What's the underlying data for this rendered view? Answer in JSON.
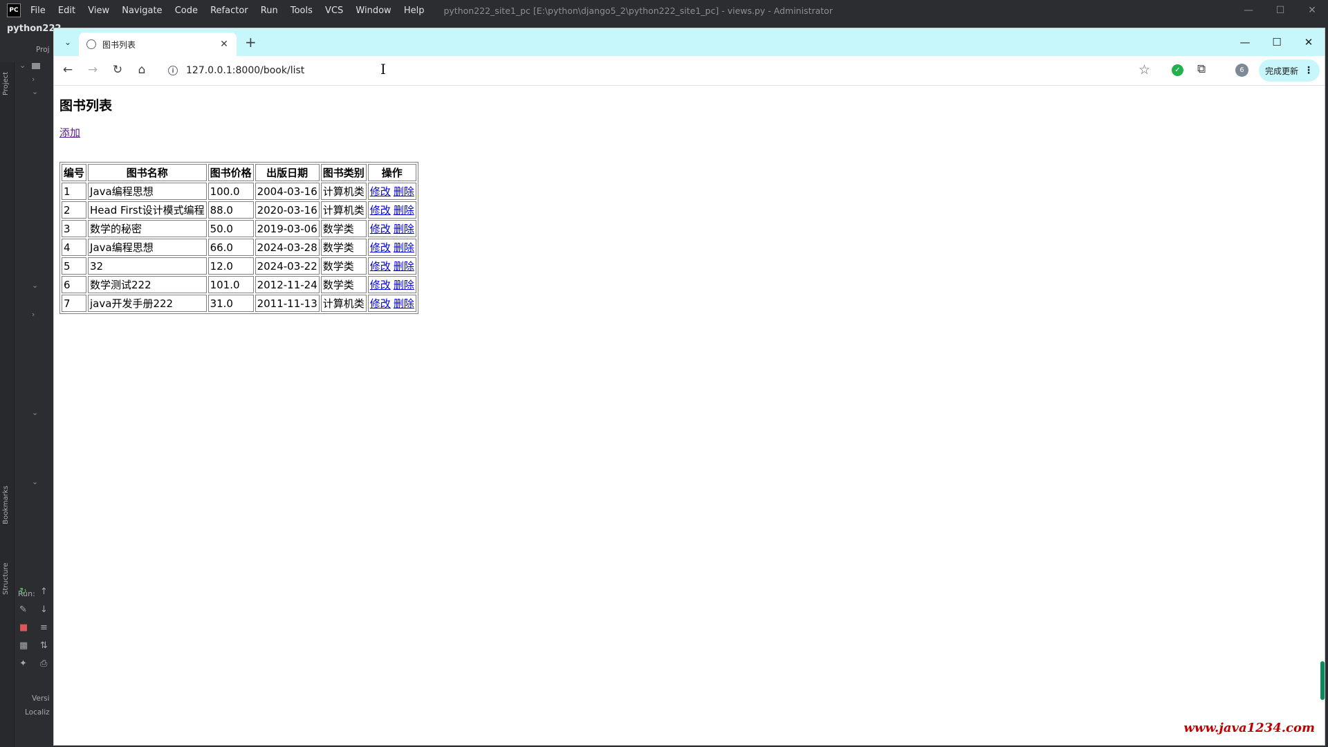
{
  "ide": {
    "logo": "PC",
    "menu": [
      "File",
      "Edit",
      "View",
      "Navigate",
      "Code",
      "Refactor",
      "Run",
      "Tools",
      "VCS",
      "Window",
      "Help"
    ],
    "window_title": "python222_site1_pc [E:\\python\\django5_2\\python222_site1_pc] - views.py - Administrator",
    "project_label": "python222",
    "project_tab": "Proj",
    "side_labels": [
      "Project",
      "Bookmarks",
      "Structure"
    ],
    "run_label": "Run:",
    "bottom_labels": [
      "Versi",
      "Localiz"
    ]
  },
  "browser": {
    "tab_title": "图书列表",
    "url": "127.0.0.1:8000/book/list",
    "update_button": "完成更新",
    "profile_initial": "6"
  },
  "page": {
    "title": "图书列表",
    "add_link": "添加",
    "table": {
      "headers": [
        "编号",
        "图书名称",
        "图书价格",
        "出版日期",
        "图书类别",
        "操作"
      ],
      "edit_label": "修改",
      "delete_label": "删除",
      "rows": [
        {
          "id": "1",
          "name": "Java编程思想",
          "price": "100.0",
          "date": "2004-03-16",
          "category": "计算机类"
        },
        {
          "id": "2",
          "name": "Head First设计模式编程",
          "price": "88.0",
          "date": "2020-03-16",
          "category": "计算机类"
        },
        {
          "id": "3",
          "name": "数学的秘密",
          "price": "50.0",
          "date": "2019-03-06",
          "category": "数学类"
        },
        {
          "id": "4",
          "name": "Java编程思想",
          "price": "66.0",
          "date": "2024-03-28",
          "category": "数学类"
        },
        {
          "id": "5",
          "name": "32",
          "price": "12.0",
          "date": "2024-03-22",
          "category": "数学类"
        },
        {
          "id": "6",
          "name": "数学测试222",
          "price": "101.0",
          "date": "2012-11-24",
          "category": "数学类"
        },
        {
          "id": "7",
          "name": "java开发手册222",
          "price": "31.0",
          "date": "2011-11-13",
          "category": "计算机类"
        }
      ]
    }
  },
  "watermark": "www.java1234.com",
  "colors": {
    "tabstrip": "#c7f7fb",
    "ide_background": "#2b2d30",
    "visited_link": "#551a8b",
    "link": "#0000ee",
    "watermark": "#c00000"
  }
}
